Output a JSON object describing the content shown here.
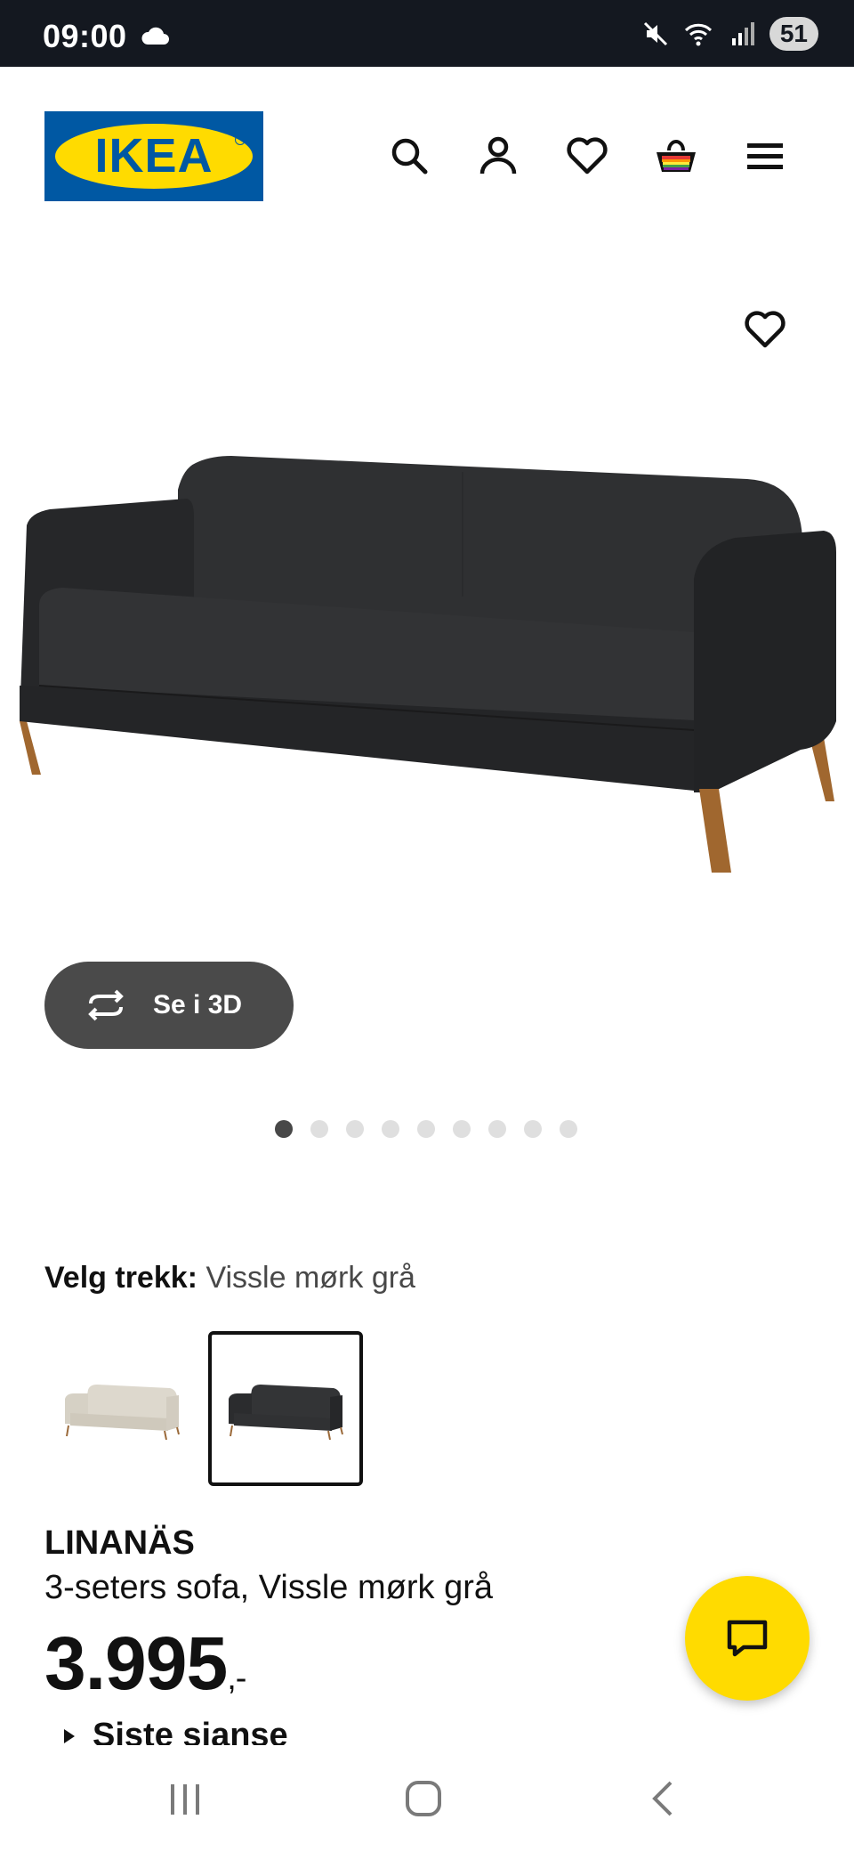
{
  "status_bar": {
    "time": "09:00",
    "battery": "51"
  },
  "header": {
    "logo_text": "IKEA",
    "icons": [
      "search-icon",
      "account-icon",
      "wishlist-icon",
      "cart-icon",
      "menu-icon"
    ]
  },
  "gallery": {
    "view_3d_label": "Se i 3D",
    "image_count": 9,
    "active_index": 0
  },
  "variant": {
    "label": "Velg trekk:",
    "value": "Vissle mørk grå",
    "options": [
      "beige",
      "dark-grey"
    ],
    "selected_index": 1
  },
  "product": {
    "name": "LINANÄS",
    "description": "3-seters sofa, Vissle mørk grå",
    "price": "3.995",
    "price_suffix": ",-",
    "notice": "Siste sjanse"
  },
  "colors": {
    "brand_blue": "#0058a3",
    "brand_yellow": "#ffdb00",
    "status_bar_bg": "#141820"
  }
}
